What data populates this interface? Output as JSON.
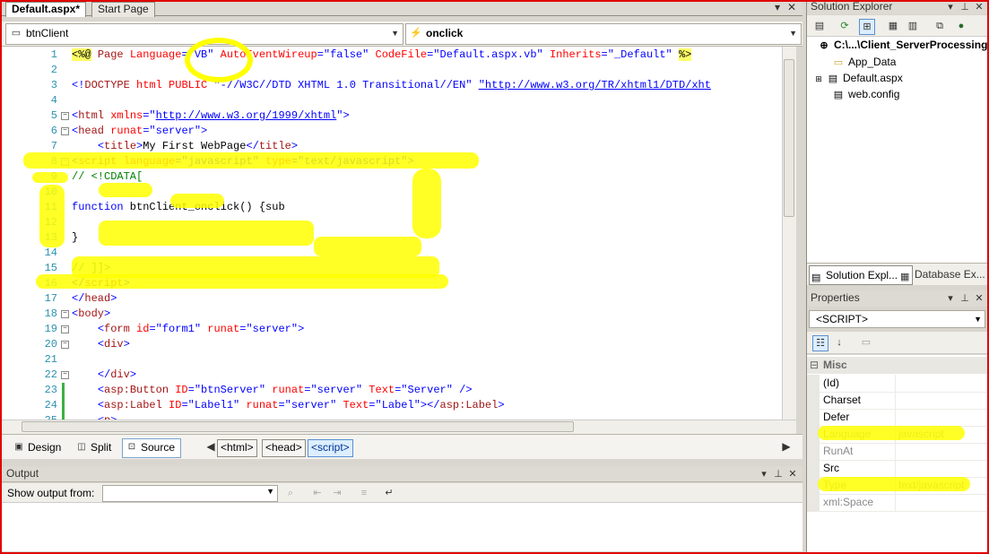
{
  "document_tabs": [
    {
      "label": "Default.aspx*"
    },
    {
      "label": "Start Page"
    }
  ],
  "nav": {
    "object_combo": "btnClient",
    "event_combo": "onclick"
  },
  "code_lines": [
    {
      "n": "1",
      "html": "<span class='hl'>&lt;%@</span> <span class='c-maroon'>Page</span> <span class='c-red'>Language</span><span class='c-blue'>=\"VB\"</span> <span class='c-red'>AutoEventWireup</span><span class='c-blue'>=\"false\"</span> <span class='c-red'>CodeFile</span><span class='c-blue'>=\"Default.aspx.vb\"</span> <span class='c-red'>Inherits</span><span class='c-blue'>=\"_Default\"</span> <span class='hl'>%&gt;</span>"
    },
    {
      "n": "2",
      "html": ""
    },
    {
      "n": "3",
      "html": "<span class='c-blue'>&lt;!</span><span class='c-maroon'>DOCTYPE</span> <span class='c-red'>html</span> <span class='c-red'>PUBLIC</span> <span class='c-blue'>\"-//W3C//DTD XHTML 1.0 Transitional//EN\"</span> <span class='c-blue' style='text-decoration:underline'>\"http://www.w3.org/TR/xhtml1/DTD/xht</span>"
    },
    {
      "n": "4",
      "html": ""
    },
    {
      "n": "5",
      "html": "<span class='c-blue'>&lt;</span><span class='c-maroon'>html</span> <span class='c-red'>xmlns</span><span class='c-blue'>=\"<u>http://www.w3.org/1999/xhtml</u>\"&gt;</span>"
    },
    {
      "n": "6",
      "html": "<span class='c-blue'>&lt;</span><span class='c-maroon'>head</span> <span class='c-red'>runat</span><span class='c-blue'>=\"server\"&gt;</span>"
    },
    {
      "n": "7",
      "html": "    <span class='c-blue'>&lt;</span><span class='c-maroon'>title</span><span class='c-blue'>&gt;</span>My First WebPage<span class='c-blue'>&lt;/</span><span class='c-maroon'>title</span><span class='c-blue'>&gt;</span>"
    },
    {
      "n": "8",
      "html": "<span class='c-blue'>&lt;</span><span class='c-maroon'>script</span> <span class='c-red'>language</span><span class='c-blue'>=\"javascript\"</span> <span class='c-red'>type</span><span class='c-blue'>=\"text/javascript\"&gt;</span>"
    },
    {
      "n": "9",
      "html": "<span class='c-green'>// &lt;!CDATA[</span>"
    },
    {
      "n": "10",
      "html": ""
    },
    {
      "n": "11",
      "html": "<span class='c-blue'>function</span> btnClient_onclick() {sub"
    },
    {
      "n": "12",
      "html": ""
    },
    {
      "n": "13",
      "html": "}"
    },
    {
      "n": "14",
      "html": ""
    },
    {
      "n": "15",
      "html": "<span class='c-green'>// ]]&gt;</span>"
    },
    {
      "n": "16",
      "html": "<span class='c-blue'>&lt;/</span><span class='c-maroon'>script</span><span class='c-blue'>&gt;</span>"
    },
    {
      "n": "17",
      "html": "<span class='c-blue'>&lt;/</span><span class='c-maroon'>head</span><span class='c-blue'>&gt;</span>"
    },
    {
      "n": "18",
      "html": "<span class='c-blue'>&lt;</span><span class='c-maroon'>body</span><span class='c-blue'>&gt;</span>"
    },
    {
      "n": "19",
      "html": "    <span class='c-blue'>&lt;</span><span class='c-maroon'>form</span> <span class='c-red'>id</span><span class='c-blue'>=\"form1\"</span> <span class='c-red'>runat</span><span class='c-blue'>=\"server\"&gt;</span>"
    },
    {
      "n": "20",
      "html": "    <span class='c-blue'>&lt;</span><span class='c-maroon'>div</span><span class='c-blue'>&gt;</span>"
    },
    {
      "n": "21",
      "html": ""
    },
    {
      "n": "22",
      "html": "    <span class='c-blue'>&lt;/</span><span class='c-maroon'>div</span><span class='c-blue'>&gt;</span>"
    },
    {
      "n": "23",
      "html": "    <span class='c-blue'>&lt;</span><span class='c-maroon'>asp:Button</span> <span class='c-red'>ID</span><span class='c-blue'>=\"btnServer\"</span> <span class='c-red'>runat</span><span class='c-blue'>=\"server\"</span> <span class='c-red'>Text</span><span class='c-blue'>=\"Server\"</span> <span class='c-blue'>/&gt;</span>"
    },
    {
      "n": "24",
      "html": "    <span class='c-blue'>&lt;</span><span class='c-maroon'>asp:Label</span> <span class='c-red'>ID</span><span class='c-blue'>=\"Label1\"</span> <span class='c-red'>runat</span><span class='c-blue'>=\"server\"</span> <span class='c-red'>Text</span><span class='c-blue'>=\"Label\"&gt;&lt;/</span><span class='c-maroon'>asp:Label</span><span class='c-blue'>&gt;</span>"
    },
    {
      "n": "25",
      "html": "    <span class='c-blue'>&lt;</span><span class='c-maroon'>p</span><span class='c-blue'>&gt;</span>"
    }
  ],
  "viewbar": {
    "design": "Design",
    "split": "Split",
    "source": "Source",
    "crumbs": [
      "<html>",
      "<head>",
      "<script>"
    ]
  },
  "output": {
    "title": "Output",
    "show_from": "Show output from:"
  },
  "solution_explorer": {
    "title": "Solution Explorer",
    "root": "C:\\...\\Client_ServerProcessing\\",
    "items": [
      "App_Data",
      "Default.aspx",
      "web.config"
    ],
    "tab1": "Solution Expl...",
    "tab2": "Database Ex..."
  },
  "properties": {
    "title": "Properties",
    "object": "<SCRIPT>",
    "category": "Misc",
    "rows": [
      {
        "name": "(Id)",
        "value": ""
      },
      {
        "name": "Charset",
        "value": ""
      },
      {
        "name": "Defer",
        "value": ""
      },
      {
        "name": "Language",
        "value": "javascript"
      },
      {
        "name": "RunAt",
        "value": ""
      },
      {
        "name": "Src",
        "value": ""
      },
      {
        "name": "Type",
        "value": "text/javascript"
      },
      {
        "name": "xml:Space",
        "value": ""
      }
    ]
  },
  "colors": {
    "frame": "#e00000",
    "highlight": "#ffff00",
    "keyword": "#0000ff",
    "tag": "#a31515",
    "attribute": "#ff0000",
    "comment": "#008000",
    "line_number": "#2b91af"
  }
}
